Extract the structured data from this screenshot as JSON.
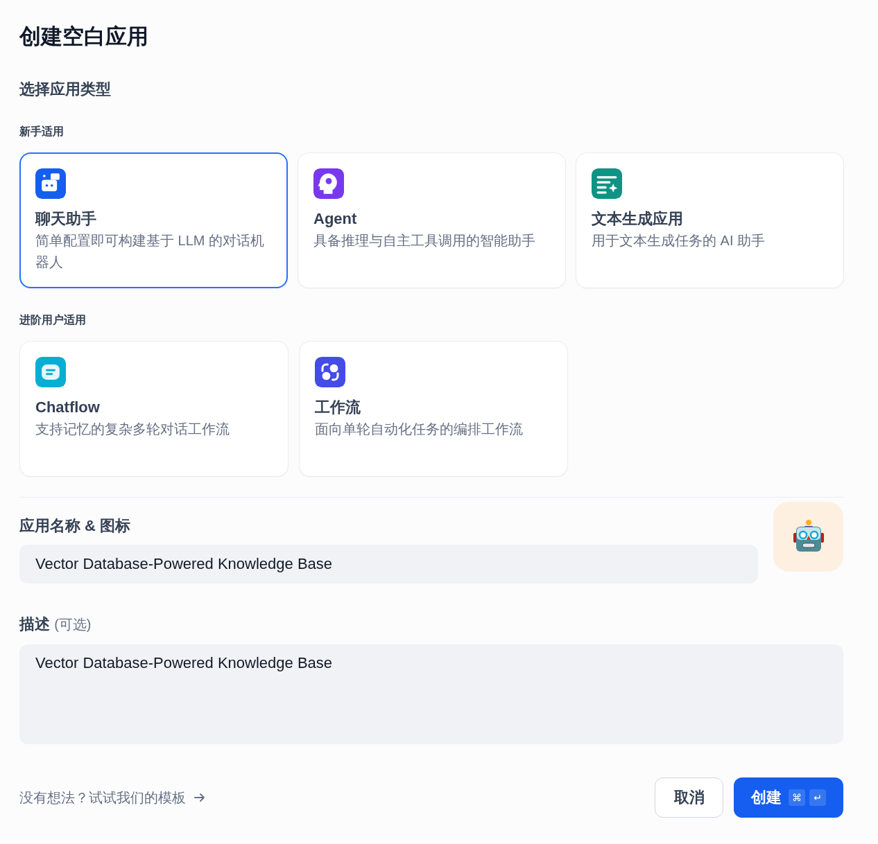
{
  "title": "创建空白应用",
  "type_heading": "选择应用类型",
  "groups": [
    {
      "label": "新手适用",
      "cards": [
        {
          "kind": "chat",
          "color": "#155eef",
          "title": "聊天助手",
          "description": "简单配置即可构建基于 LLM 的对话机器人",
          "selected": true
        },
        {
          "kind": "agent",
          "color": "#7839ee",
          "title": "Agent",
          "description": "具备推理与自主工具调用的智能助手",
          "selected": false
        },
        {
          "kind": "text",
          "color": "#0e9384",
          "title": "文本生成应用",
          "description": "用于文本生成任务的 AI 助手",
          "selected": false
        }
      ]
    },
    {
      "label": "进阶用户适用",
      "cards": [
        {
          "kind": "chatflow",
          "color": "#06aed4",
          "title": "Chatflow",
          "description": "支持记忆的复杂多轮对话工作流",
          "selected": false
        },
        {
          "kind": "workflow",
          "color": "#444ce7",
          "title": "工作流",
          "description": "面向单轮自动化任务的编排工作流",
          "selected": false
        }
      ]
    }
  ],
  "name_label": "应用名称 & 图标",
  "name_value": "Vector Database-Powered Knowledge Base",
  "description_label": "描述",
  "description_optional": "(可选)",
  "description_value": "Vector Database-Powered Knowledge Base",
  "template_link": "没有想法？试试我们的模板",
  "cancel_button": "取消",
  "create_button": {
    "label": "创建",
    "keys": [
      "⌘",
      "↵"
    ]
  }
}
